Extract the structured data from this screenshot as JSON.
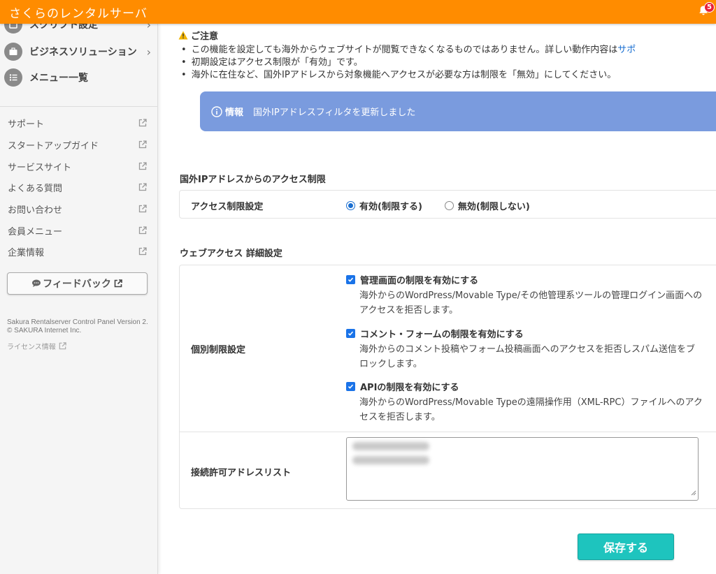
{
  "header": {
    "brand": "さくらのレンタルサーバ",
    "notification_count": "5",
    "bg_color": "#ff8c00"
  },
  "sidebar": {
    "nav": [
      {
        "label": "スクリプト設定",
        "icon": "script-icon"
      },
      {
        "label": "ビジネスソリューション",
        "icon": "briefcase-icon"
      },
      {
        "label": "メニュー一覧",
        "icon": "list-icon"
      }
    ],
    "links": [
      {
        "label": "サポート"
      },
      {
        "label": "スタートアップガイド"
      },
      {
        "label": "サービスサイト"
      },
      {
        "label": "よくある質問"
      },
      {
        "label": "お問い合わせ"
      },
      {
        "label": "会員メニュー"
      },
      {
        "label": "企業情報"
      }
    ],
    "feedback_label": "フィードバック",
    "version_text": "Sakura Rentalserver Control Panel Version 2. © SAKURA Internet Inc.",
    "license_label": "ライセンス情報"
  },
  "main": {
    "caution": {
      "title": "ご注意",
      "items": [
        "この機能を設定しても海外からウェブサイトが閲覧できなくなるものではありません。詳しい動作内容は",
        "初期設定はアクセス制限が「有効」です。",
        "海外に在住など、国外IPアドレスから対象機能へアクセスが必要な方は制限を「無効」にしてください。"
      ],
      "link_text": "サポ"
    },
    "info": {
      "label": "情報",
      "message": "国外IPアドレスフィルタを更新しました"
    },
    "access_section": {
      "title": "国外IPアドレスからのアクセス制限",
      "row_label": "アクセス制限設定",
      "options": [
        {
          "label": "有効(制限する)",
          "selected": true
        },
        {
          "label": "無効(制限しない)",
          "selected": false
        }
      ]
    },
    "web_section": {
      "title": "ウェブアクセス 詳細設定",
      "individual_label": "個別制限設定",
      "checks": [
        {
          "label": "管理画面の制限を有効にする",
          "checked": true,
          "desc": "海外からのWordPress/Movable Type/その他管理系ツールの管理ログイン画面へのアクセスを拒否します。"
        },
        {
          "label": "コメント・フォームの制限を有効にする",
          "checked": true,
          "desc": "海外からのコメント投稿やフォーム投稿画面へのアクセスを拒否しスパム送信をブロックします。"
        },
        {
          "label": "APIの制限を有効にする",
          "checked": true,
          "desc": "海外からのWordPress/Movable Typeの遠隔操作用（XML-RPC）ファイルへのアクセスを拒否します。"
        }
      ],
      "allow_list_label": "接続許可アドレスリスト"
    },
    "save_label": "保存する",
    "save_color": "#1ec4be",
    "info_color": "#7a9bde"
  }
}
